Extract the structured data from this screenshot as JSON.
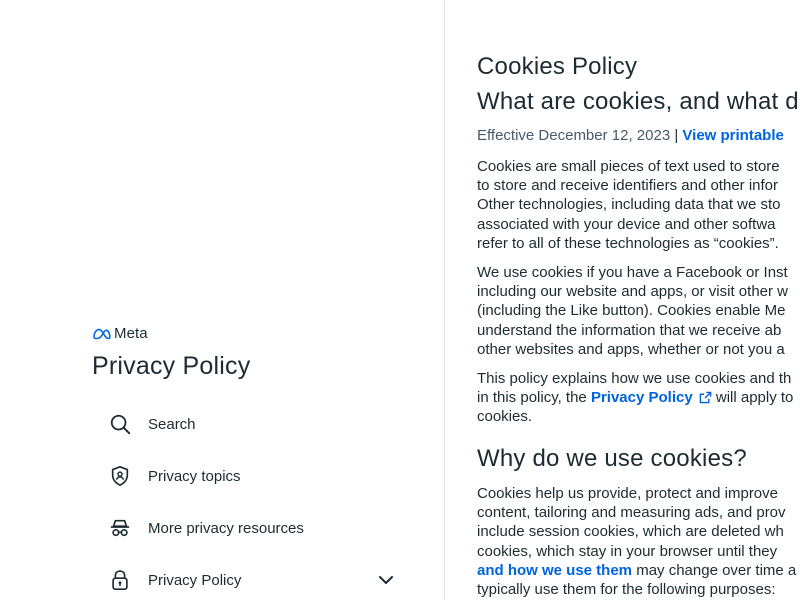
{
  "sidebar": {
    "brand": "Meta",
    "title": "Privacy Policy",
    "items": [
      {
        "label": "Search",
        "icon": "search-icon"
      },
      {
        "label": "Privacy topics",
        "icon": "shield-lock-icon"
      },
      {
        "label": "More privacy resources",
        "icon": "incognito-icon"
      },
      {
        "label": "Privacy Policy",
        "icon": "lock-icon"
      }
    ]
  },
  "main": {
    "title": "Cookies Policy",
    "subtitle": "What are cookies, and what d",
    "effective": "Effective December 12, 2023",
    "separator": "|",
    "printable_link": "View printable",
    "p1": [
      "Cookies are small pieces of text used to store",
      "to store and receive identifiers and other infor",
      "Other technologies, including data that we sto",
      "associated with your device and other softwa",
      "refer to all of these technologies as “cookies”."
    ],
    "p2": [
      "We use cookies if you have a Facebook or Inst",
      "including our website and apps, or visit other w",
      "(including the Like button). Cookies enable Me",
      "understand the information that we receive ab",
      "other websites and apps, whether or not you a"
    ],
    "p3_line1": "This policy explains how we use cookies and th",
    "p3_line2_pre": "in this policy, the ",
    "p3_link": "Privacy Policy",
    "p3_line2_post": " will apply to",
    "p3_line3": "cookies.",
    "section2_title": "Why do we use cookies?",
    "p4": [
      "Cookies help us provide, protect and improve",
      "content, tailoring and measuring ads, and prov",
      "include session cookies, which are deleted wh",
      "cookies, which stay in your browser until they"
    ],
    "p4_link": "and how we use them",
    "p4_line5_post": " may change over time a",
    "p4_line6": "typically use them for the following purposes:"
  },
  "colors": {
    "link": "#0064e0",
    "text": "#1c2b33",
    "muted": "#465a69",
    "border": "#dee3e9",
    "meta_blue": "#0668E1"
  }
}
